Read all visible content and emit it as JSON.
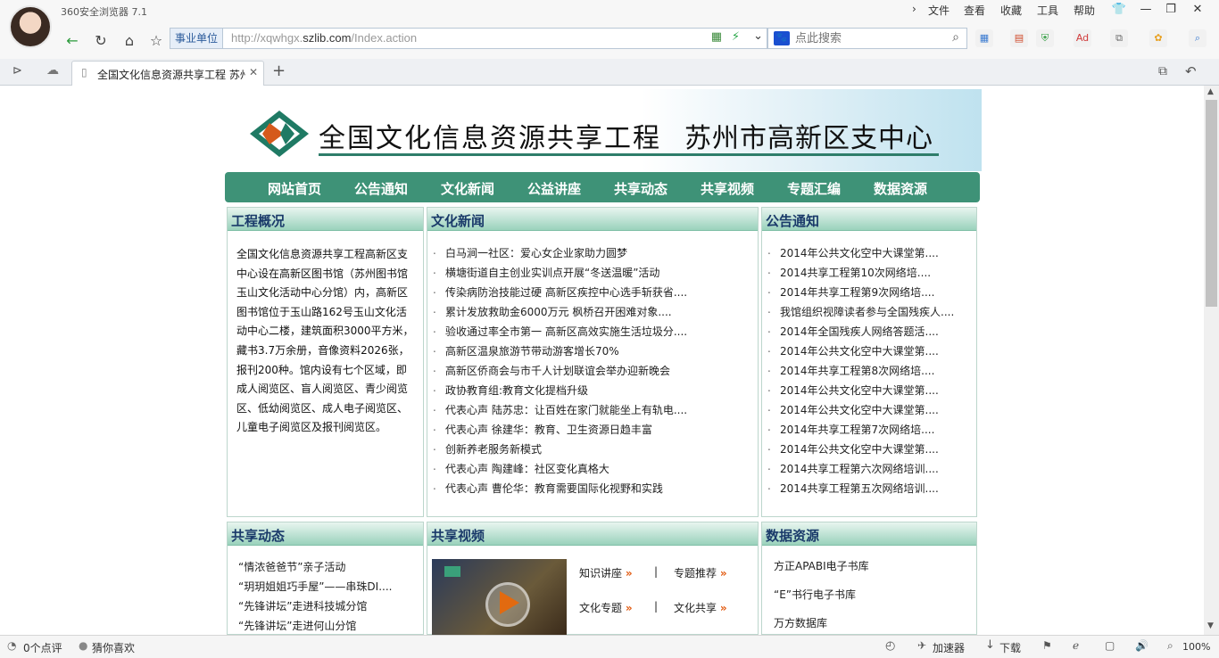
{
  "browser": {
    "app_title": "360安全浏览器 7.1",
    "menu": [
      "文件",
      "查看",
      "收藏",
      "工具",
      "帮助"
    ],
    "address_badge": "事业单位",
    "url_prefix": "http://xqwhgx.",
    "url_domain": "szlib.com",
    "url_path": "/Index.action",
    "search_placeholder": "点此搜索",
    "tab_title": "全国文化信息资源共享工程 苏州",
    "status": {
      "comments": "0个点评",
      "guess": "猜你喜欢",
      "accelerator": "加速器",
      "download": "下载",
      "zoom": "100%"
    }
  },
  "site": {
    "title": "全国文化信息资源共享工程",
    "subtitle": "苏州市高新区支中心",
    "nav": [
      "网站首页",
      "公告通知",
      "文化新闻",
      "公益讲座",
      "共享动态",
      "共享视频",
      "专题汇编",
      "数据资源"
    ]
  },
  "sections": {
    "overview": {
      "title": "工程概况",
      "text": "全国文化信息资源共享工程高新区支中心设在高新区图书馆（苏州图书馆玉山文化活动中心分馆）内，高新区图书馆位于玉山路162号玉山文化活动中心二楼，建筑面积3000平方米，藏书3.7万余册，音像资料2026张，报刊200种。馆内设有七个区域，即成人阅览区、盲人阅览区、青少阅览区、低幼阅览区、成人电子阅览区、儿童电子阅览区及报刊阅览区。"
    },
    "news": {
      "title": "文化新闻",
      "items": [
        "白马涧一社区：爱心女企业家助力圆梦",
        "横塘街道自主创业实训点开展“冬送温暖”活动",
        "传染病防治技能过硬 高新区疾控中心选手斩获省....",
        "累计发放救助金6000万元 枫桥召开困难对象....",
        "验收通过率全市第一 高新区高效实施生活垃圾分....",
        "高新区温泉旅游节带动游客增长70%",
        "高新区侨商会与市千人计划联谊会举办迎新晚会",
        "政协教育组:教育文化提档升级",
        "代表心声 陆苏忠：让百姓在家门就能坐上有轨电....",
        "代表心声 徐建华：教育、卫生资源日趋丰富",
        "创新养老服务新模式",
        "代表心声 陶建峰：社区变化真格大",
        "代表心声 曹伦华：教育需要国际化视野和实践"
      ]
    },
    "notices": {
      "title": "公告通知",
      "items": [
        "2014年公共文化空中大课堂第....",
        "2014共享工程第10次网络培....",
        "2014年共享工程第9次网络培....",
        "我馆组织视障读者参与全国残疾人....",
        "2014年全国残疾人网络答题活....",
        "2014年公共文化空中大课堂第....",
        "2014年共享工程第8次网络培....",
        "2014年公共文化空中大课堂第....",
        "2014年公共文化空中大课堂第....",
        "2014年共享工程第7次网络培....",
        "2014年公共文化空中大课堂第....",
        "2014共享工程第六次网络培训....",
        "2014共享工程第五次网络培训...."
      ]
    },
    "dynamics": {
      "title": "共享动态",
      "items": [
        "“情浓爸爸节”亲子活动",
        "“玥玥姐姐巧手屋”——串珠DI....",
        "“先锋讲坛”走进科技城分馆",
        "“先锋讲坛”走进何山分馆"
      ]
    },
    "video": {
      "title": "共享视频",
      "links": [
        "知识讲座",
        "专题推荐",
        "文化专题",
        "文化共享"
      ],
      "separator": "|"
    },
    "data": {
      "title": "数据资源",
      "items": [
        "方正APABI电子书库",
        "“E”书行电子书库",
        "万方数据库"
      ]
    }
  },
  "colors": {
    "nav_bg": "#3e9277",
    "head_text": "#1a3a6a",
    "arrow": "#e25a10"
  }
}
